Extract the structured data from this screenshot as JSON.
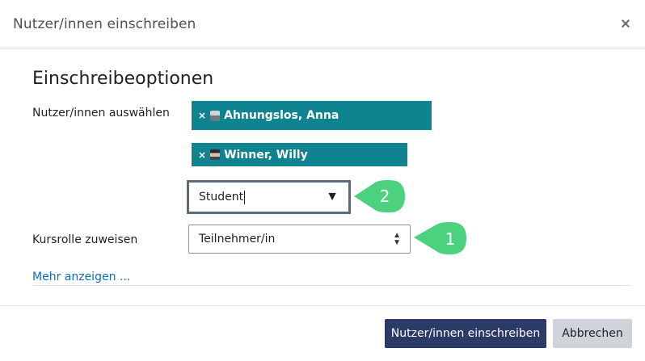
{
  "dialog": {
    "title": "Nutzer/innen einschreiben",
    "close_icon": "close-icon",
    "close_glyph": "×"
  },
  "form": {
    "section_title": "Einschreibeoptionen",
    "select_users_label": "Nutzer/innen auswählen",
    "selected_users": [
      {
        "remove_glyph": "×",
        "name": "Ahnungslos, Anna",
        "avatar": "user-avatar-icon"
      },
      {
        "remove_glyph": "×",
        "name": "Winner, Willy",
        "avatar": "user-avatar-icon"
      }
    ],
    "search_value": "Student",
    "search_dropdown_glyph": "▼",
    "role_label": "Kursrolle zuweisen",
    "role_selected": "Teilnehmer/in",
    "show_more_link": "Mehr anzeigen ..."
  },
  "annotations": [
    {
      "number": "2",
      "color": "#4cd17f"
    },
    {
      "number": "1",
      "color": "#4cd17f"
    }
  ],
  "footer": {
    "enrol_button": "Nutzer/innen einschreiben",
    "cancel_button": "Abbrechen"
  },
  "colors": {
    "chip": "#0f8390",
    "primary_button": "#2b3a67",
    "secondary_button": "#ced4da",
    "link": "#0f6cbf"
  }
}
